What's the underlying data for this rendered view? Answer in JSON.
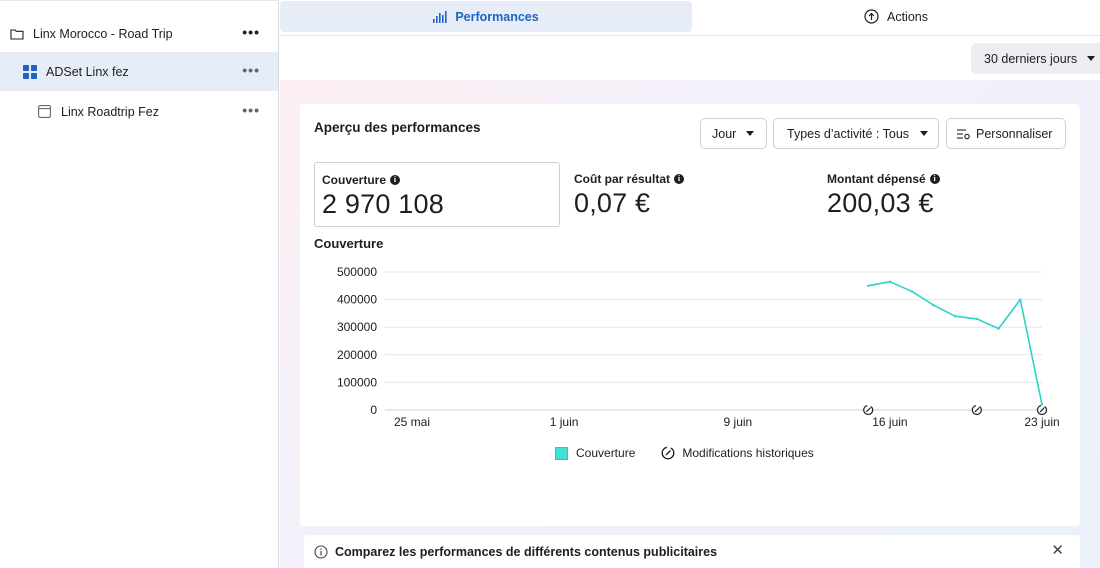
{
  "sidebar": {
    "items": [
      {
        "label": "Linx Morocco - Road Trip",
        "icon": "folder-icon",
        "more": "•••"
      },
      {
        "label": "ADSet Linx fez",
        "icon": "adset-grid-icon",
        "more": "•••"
      },
      {
        "label": "Linx Roadtrip Fez",
        "icon": "ad-window-icon",
        "more": "•••"
      }
    ]
  },
  "tabs": {
    "performances": "Performances",
    "actions": "Actions"
  },
  "date_range": "30 derniers jours",
  "card": {
    "title": "Aperçu des performances",
    "jour_button": "Jour",
    "activity_button": "Types d’activité : Tous",
    "customize_button": "Personnaliser",
    "metrics": [
      {
        "label": "Couverture",
        "value": "2 970 108"
      },
      {
        "label": "Coût par résultat",
        "value": "0,07 €"
      },
      {
        "label": "Montant dépensé",
        "value": "200,03 €"
      }
    ],
    "chart_title": "Couverture",
    "legend": {
      "series": "Couverture",
      "history": "Modifications historiques"
    }
  },
  "chart_data": {
    "type": "line",
    "title": "Couverture",
    "xlabel": "",
    "ylabel": "",
    "x_tick_labels": [
      "25 mai",
      "1 juin",
      "9 juin",
      "16 juin",
      "23 juin"
    ],
    "y_tick_labels": [
      "0",
      "100000",
      "200000",
      "300000",
      "400000",
      "500000"
    ],
    "ylim": [
      0,
      500000
    ],
    "series": [
      {
        "name": "Couverture",
        "color": "#2ed3c8",
        "x": [
          "15 juin",
          "16 juin",
          "17 juin",
          "18 juin",
          "19 juin",
          "20 juin",
          "21 juin",
          "22 juin",
          "23 juin"
        ],
        "values": [
          450000,
          465000,
          430000,
          380000,
          340000,
          330000,
          295000,
          400000,
          20000
        ]
      }
    ],
    "history_markers": [
      "15 juin",
      "20 juin",
      "23 juin"
    ],
    "grid": true,
    "legend_position": "bottom"
  },
  "banner": {
    "text": "Comparez les performances de différents contenus publicitaires"
  }
}
